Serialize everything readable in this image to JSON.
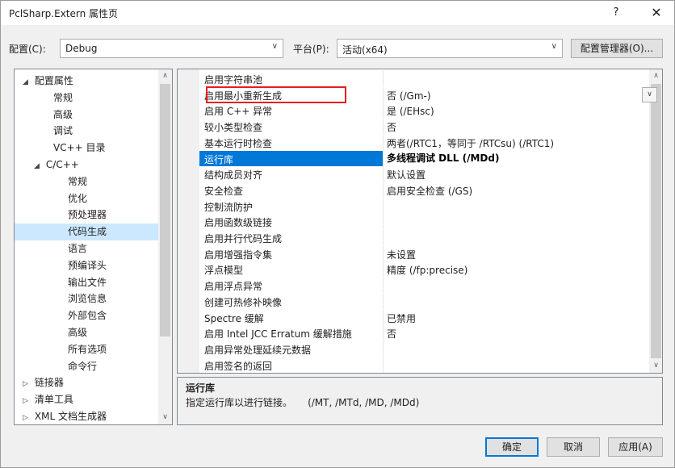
{
  "window": {
    "title": "PclSharp.Extern 属性页",
    "help": "?",
    "close": "✕"
  },
  "toolbar": {
    "config_label": "配置(C):",
    "config_value": "Debug",
    "platform_label": "平台(P):",
    "platform_value": "活动(x64)",
    "config_manager": "配置管理器(O)..."
  },
  "tree": {
    "items": [
      {
        "label": "配置属性",
        "expander": "◢"
      },
      {
        "label": "常规"
      },
      {
        "label": "高级"
      },
      {
        "label": "调试"
      },
      {
        "label": "VC++ 目录"
      },
      {
        "label": "C/C++",
        "expander": "◢"
      },
      {
        "label": "常规"
      },
      {
        "label": "优化"
      },
      {
        "label": "预处理器"
      },
      {
        "label": "代码生成",
        "selected": true
      },
      {
        "label": "语言"
      },
      {
        "label": "预编译头"
      },
      {
        "label": "输出文件"
      },
      {
        "label": "浏览信息"
      },
      {
        "label": "外部包含"
      },
      {
        "label": "高级"
      },
      {
        "label": "所有选项"
      },
      {
        "label": "命令行"
      },
      {
        "label": "链接器",
        "expander": "▷"
      },
      {
        "label": "清单工具",
        "expander": "▷"
      },
      {
        "label": "XML 文档生成器",
        "expander": "▷"
      }
    ]
  },
  "grid": {
    "rows": [
      {
        "name": "启用字符串池",
        "value": ""
      },
      {
        "name": "启用最小重新生成",
        "value": "否 (/Gm-)"
      },
      {
        "name": "启用 C++ 异常",
        "value": "是 (/EHsc)"
      },
      {
        "name": "较小类型检查",
        "value": "否"
      },
      {
        "name": "基本运行时检查",
        "value": "两者(/RTC1，等同于 /RTCsu) (/RTC1)"
      },
      {
        "name": "运行库",
        "value": "多线程调试 DLL (/MDd)",
        "selected": true
      },
      {
        "name": "结构成员对齐",
        "value": "默认设置"
      },
      {
        "name": "安全检查",
        "value": "启用安全检查 (/GS)"
      },
      {
        "name": "控制流防护",
        "value": ""
      },
      {
        "name": "启用函数级链接",
        "value": ""
      },
      {
        "name": "启用并行代码生成",
        "value": ""
      },
      {
        "name": "启用增强指令集",
        "value": "未设置"
      },
      {
        "name": "浮点模型",
        "value": "精度 (/fp:precise)"
      },
      {
        "name": "启用浮点异常",
        "value": ""
      },
      {
        "name": "创建可热修补映像",
        "value": ""
      },
      {
        "name": "Spectre 缓解",
        "value": "已禁用"
      },
      {
        "name": "启用 Intel JCC Erratum 缓解措施",
        "value": "否"
      },
      {
        "name": "启用异常处理延续元数据",
        "value": ""
      },
      {
        "name": "启用签名的返回",
        "value": ""
      }
    ]
  },
  "description": {
    "title": "运行库",
    "text": "指定运行库以进行链接。     (/MT, /MTd, /MD, /MDd)"
  },
  "buttons": {
    "ok": "确定",
    "cancel": "取消",
    "apply": "应用(A)"
  },
  "icons": {
    "dropdown": "∨",
    "scroll_up": "∧",
    "scroll_down": "∨"
  }
}
